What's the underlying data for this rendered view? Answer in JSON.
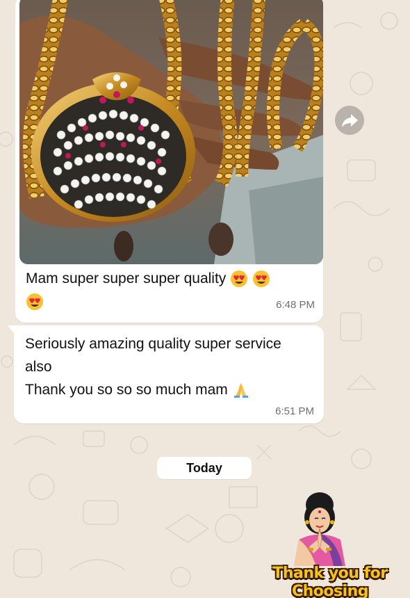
{
  "chat": {
    "messages": [
      {
        "image_alt": "gold necklace with stone-studded pendant held in hand",
        "text_line1": "Mam super super super quality",
        "time": "6:48 PM"
      },
      {
        "line1": "Seriously amazing quality super service",
        "line2": "also",
        "line3": "Thank you so so so much mam",
        "time": "6:51 PM"
      }
    ],
    "day_separator": "Today",
    "sticker": {
      "line1": "Thank you for",
      "line2": "Choosing"
    }
  },
  "colors": {
    "wallpaper": "#efe7dc",
    "bubble": "#ffffff",
    "timestamp": "#6f6f6f",
    "forward_button": "#b9b3ab"
  },
  "icons": [
    "heart-eyes-emoji-icon",
    "folded-hands-emoji-icon",
    "forward-arrow-icon"
  ]
}
